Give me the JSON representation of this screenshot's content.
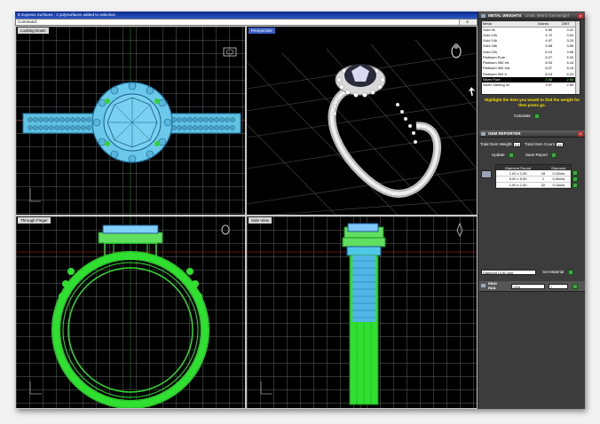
{
  "window": {
    "title": "E Express Surfaces : 2 polysurfaces added to selection",
    "command_label": "Command:",
    "command_select": "4"
  },
  "viewports": [
    {
      "id": "top",
      "title": "Looking Down"
    },
    {
      "id": "perspective",
      "title": "Perspective"
    },
    {
      "id": "front",
      "title": "Through Finger"
    },
    {
      "id": "side",
      "title": "Side View"
    }
  ],
  "metal_weights": {
    "title": "METAL WEIGHTS",
    "tab2": "Units: Metric Gemweight",
    "columns": [
      "Metal",
      "Grams",
      "DWT"
    ],
    "rows": [
      [
        "Gold 9k",
        "4.69",
        "3.02"
      ],
      [
        "Gold 10k",
        "4.72",
        "3.04"
      ],
      [
        "Gold 14k",
        "4.97",
        "3.20"
      ],
      [
        "Gold 18k",
        "5.58",
        "3.59"
      ],
      [
        "Gold 22k",
        "6.19",
        "3.98"
      ],
      [
        "Platinum Pure",
        "8.27",
        "5.32"
      ],
      [
        "Platinum 950 Ird",
        "8.03",
        "5.16"
      ],
      [
        "Platinum 950 Ir/d",
        "8.07",
        "5.18"
      ],
      [
        "Platinum 900 Ir",
        "8.14",
        "5.24"
      ],
      [
        "Silver Pure",
        "3.98",
        "2.56"
      ],
      [
        "Silver Sterling 92",
        "3.97",
        "2.55"
      ]
    ],
    "selected_row": 9,
    "hint": "Highlight the item you would to find the weight for then press go.",
    "calculate_label": "Calculate"
  },
  "gem_reporter": {
    "title": "GEM REPORTER",
    "total_weight_label": "Total Gem Weight",
    "total_weight_value": "0.8",
    "total_count_label": "Total Gem Count",
    "total_count_value": "49",
    "update_label": "Update",
    "save_report_label": "Save Report",
    "columns": [
      "Diamond Round",
      "",
      "Diamond"
    ],
    "rows": [
      [
        "1.00 x 1.00",
        "16",
        "0.10ctw"
      ],
      [
        "5.00 x 5.00",
        "1",
        "0.50ctw"
      ],
      [
        "1.00 x 1.00",
        "32",
        "0.15ctw"
      ]
    ],
    "material_value": "Diamond (3.52 g/g)",
    "set_material_label": "Set Material"
  },
  "ring_rail": {
    "label_line1": "RING",
    "label_line2": "RAIL",
    "country": "USA",
    "size": "7"
  },
  "colors": {
    "wire_green": "#2fe030",
    "wire_blue": "#4fb6e6",
    "grid": "#555555",
    "panel_bg": "#3c3c3c",
    "title_blue": "#0c2a8e",
    "highlight_yellow": "#f6e000"
  }
}
